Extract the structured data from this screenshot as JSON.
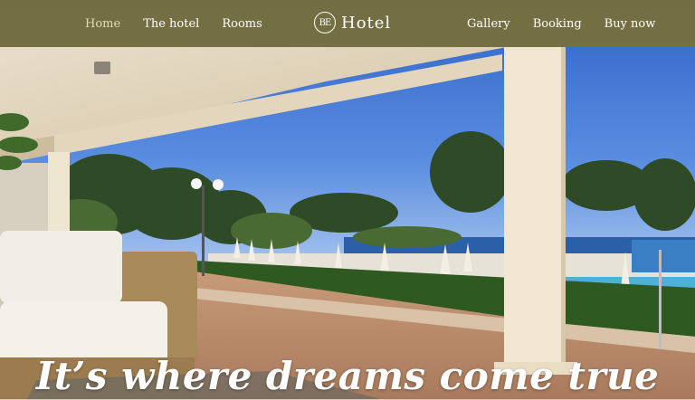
{
  "nav": {
    "left_links": [
      {
        "label": "Home",
        "active": true
      },
      {
        "label": "The hotel",
        "active": false
      },
      {
        "label": "Rooms",
        "active": false
      }
    ],
    "right_links": [
      {
        "label": "Gallery"
      },
      {
        "label": "Booking"
      },
      {
        "label": "Buy now"
      }
    ],
    "bar_color": "#7e702c"
  },
  "brand": {
    "monogram": "BE",
    "name": "Hotel"
  },
  "hero": {
    "tagline": "It’s where dreams come true",
    "image_subject": "hotel terrace with wicker sofa, columns and view over pool, pine trees and sea"
  }
}
